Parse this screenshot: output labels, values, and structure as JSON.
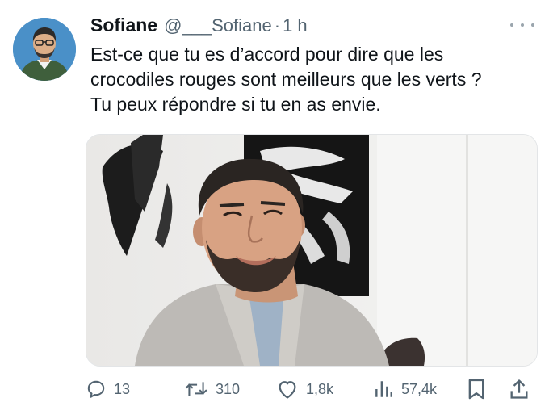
{
  "tweet": {
    "author_name": "Sofiane",
    "handle": "@___Sofiane",
    "separator": "·",
    "time": "1 h",
    "text_lines": [
      "Est-ce que tu es d’accord pour dire que les",
      "crocodiles rouges sont meilleurs que les verts ?",
      "Tu peux répondre si tu en as envie."
    ]
  },
  "actions": {
    "replies": "13",
    "retweets": "310",
    "likes": "1,8k",
    "views": "57,4k"
  },
  "icons": {
    "more": "more-horizontal-icon",
    "reply": "reply-bubble-icon",
    "retweet": "retweet-icon",
    "like": "heart-icon",
    "views": "bar-chart-icon",
    "bookmark": "bookmark-icon",
    "share": "share-icon"
  },
  "colors": {
    "text": "#0f1419",
    "muted": "#536471",
    "avatar_bg": "#4a90c8"
  }
}
